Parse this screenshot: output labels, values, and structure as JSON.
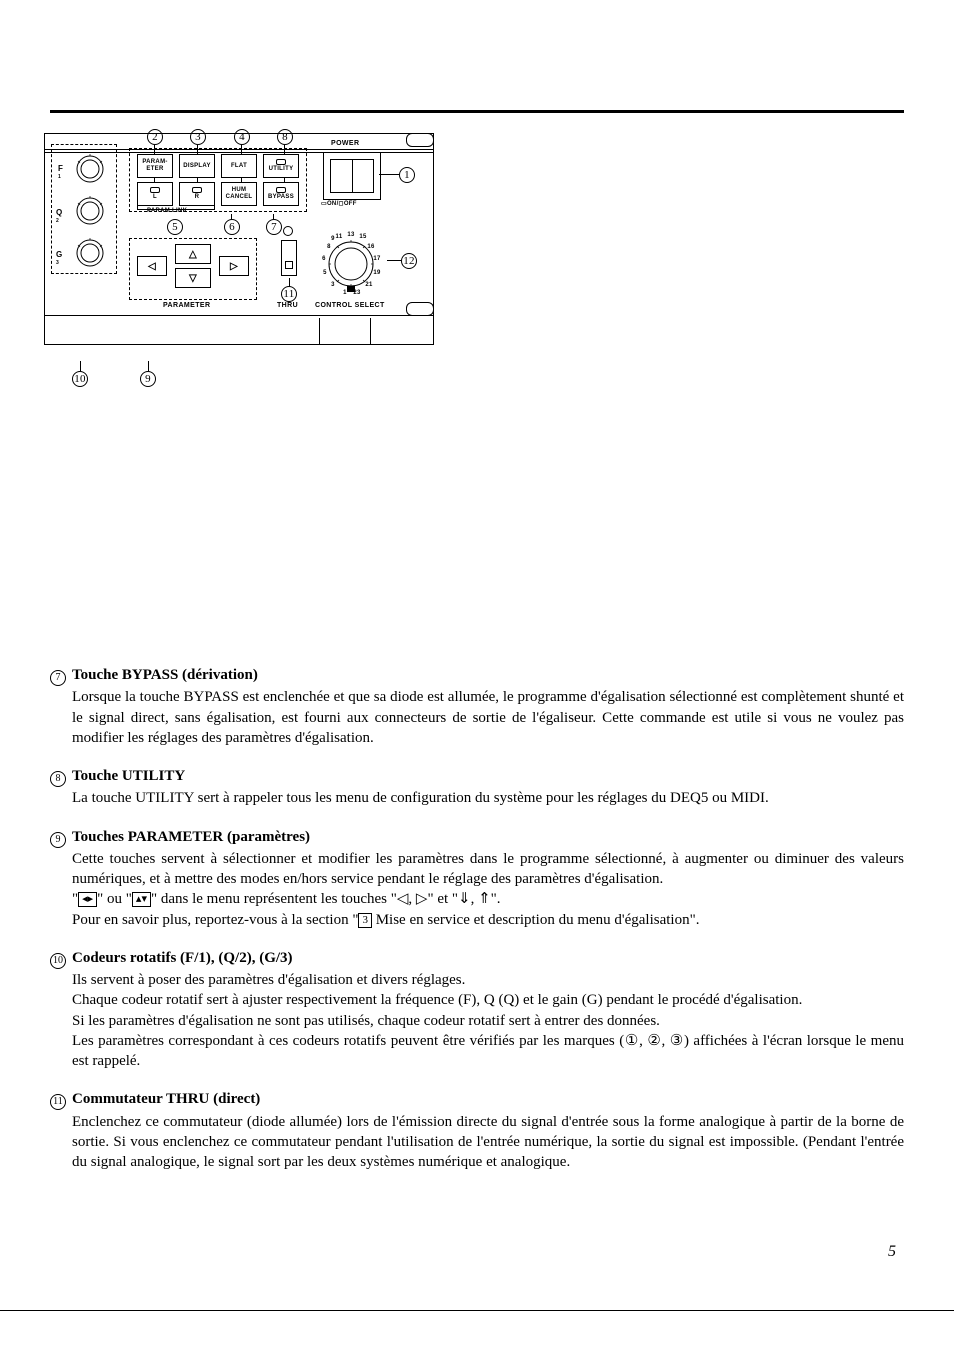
{
  "diagram": {
    "callouts_top": [
      "2",
      "3",
      "4",
      "8"
    ],
    "callout_right_power": "1",
    "callout_select": "12",
    "callout_thru": "11",
    "callouts_mid": [
      "6",
      "7"
    ],
    "callout_paramlink": "5",
    "callouts_bottom": [
      "10",
      "9"
    ],
    "labels": {
      "power": "POWER",
      "parameter_btn": "PARAM-\nETER",
      "display": "DISPLAY",
      "flat": "FLAT",
      "utility": "UTILITY",
      "l": "L",
      "r": "R",
      "hum": "HUM\nCANCEL",
      "bypass": "BYPASS",
      "param_link": "PARAM LINK",
      "on_off": "▭ON/◻OFF",
      "thru": "THRU",
      "control_select": "CONTROL SELECT",
      "parameter": "PARAMETER",
      "f1": "F/1",
      "q2": "Q/2",
      "g3": "G/3"
    },
    "dial_numbers": [
      "1",
      "3",
      "5",
      "6",
      "8",
      "9",
      "11",
      "13",
      "15",
      "16",
      "17",
      "19",
      "21",
      "23"
    ]
  },
  "sections": [
    {
      "num": "7",
      "title": "Touche BYPASS (dérivation)",
      "paragraphs": [
        "Lorsque la touche BYPASS est enclenchée et que sa diode est allumée, le programme d'égalisation sélectionné est complètement shunté et le signal direct, sans égalisation, est fourni aux connecteurs de sortie de l'égaliseur. Cette commande est utile si vous ne voulez pas modifier les réglages des paramètres d'égalisation."
      ]
    },
    {
      "num": "8",
      "title": "Touche UTILITY",
      "paragraphs": [
        "La touche UTILITY sert à rappeler tous les menu de configuration du système pour les réglages du DEQ5 ou MIDI."
      ]
    },
    {
      "num": "9",
      "title": "Touches PARAMETER (paramètres)",
      "paragraphs": [
        "Cette touches servent à sélectionner et modifier les paramètres dans le programme sélectionné, à augmenter ou diminuer des valeurs numériques, et à mettre des modes en/hors service pendant le réglage des paramètres d'égalisation."
      ],
      "special_line_prefix": "\"",
      "special_icon1": "◂▸",
      "special_mid1": "\" ou \"",
      "special_icon2": "▴▾",
      "special_mid2": "\" dans le menu représentent les touches \"◁, ▷\" et \"⇓, ⇑\".",
      "followup": "Pour en savoir plus, reportez-vous à la section \"",
      "followup_box": "3",
      "followup_end": " Mise en service et description du menu d'égalisation\"."
    },
    {
      "num": "10",
      "title": "Codeurs rotatifs (F/1), (Q/2), (G/3)",
      "paragraphs": [
        "Ils servent à poser des paramètres d'égalisation et divers réglages.",
        "Chaque codeur rotatif sert à ajuster respectivement la fréquence (F), Q (Q) et le gain (G) pendant le procédé d'égalisation.",
        "Si les paramètres d'égalisation ne sont pas utilisés, chaque codeur rotatif sert à entrer des données.",
        "Les paramètres correspondant à ces codeurs rotatifs peuvent être vérifiés par les marques (①, ②, ③) affichées à l'écran lorsque le menu est rappelé."
      ]
    },
    {
      "num": "11",
      "title": "Commutateur THRU (direct)",
      "paragraphs": [
        "Enclenchez ce commutateur (diode allumée) lors de l'émission directe du signal d'entrée sous la forme analogique à partir de la borne de sortie. Si vous enclenchez ce commutateur pendant l'utilisation de l'entrée numérique, la sortie du signal est impossible. (Pendant l'entrée du signal analogique, le signal sort par les deux systèmes numérique et analogique."
      ]
    }
  ],
  "page_number": "5"
}
